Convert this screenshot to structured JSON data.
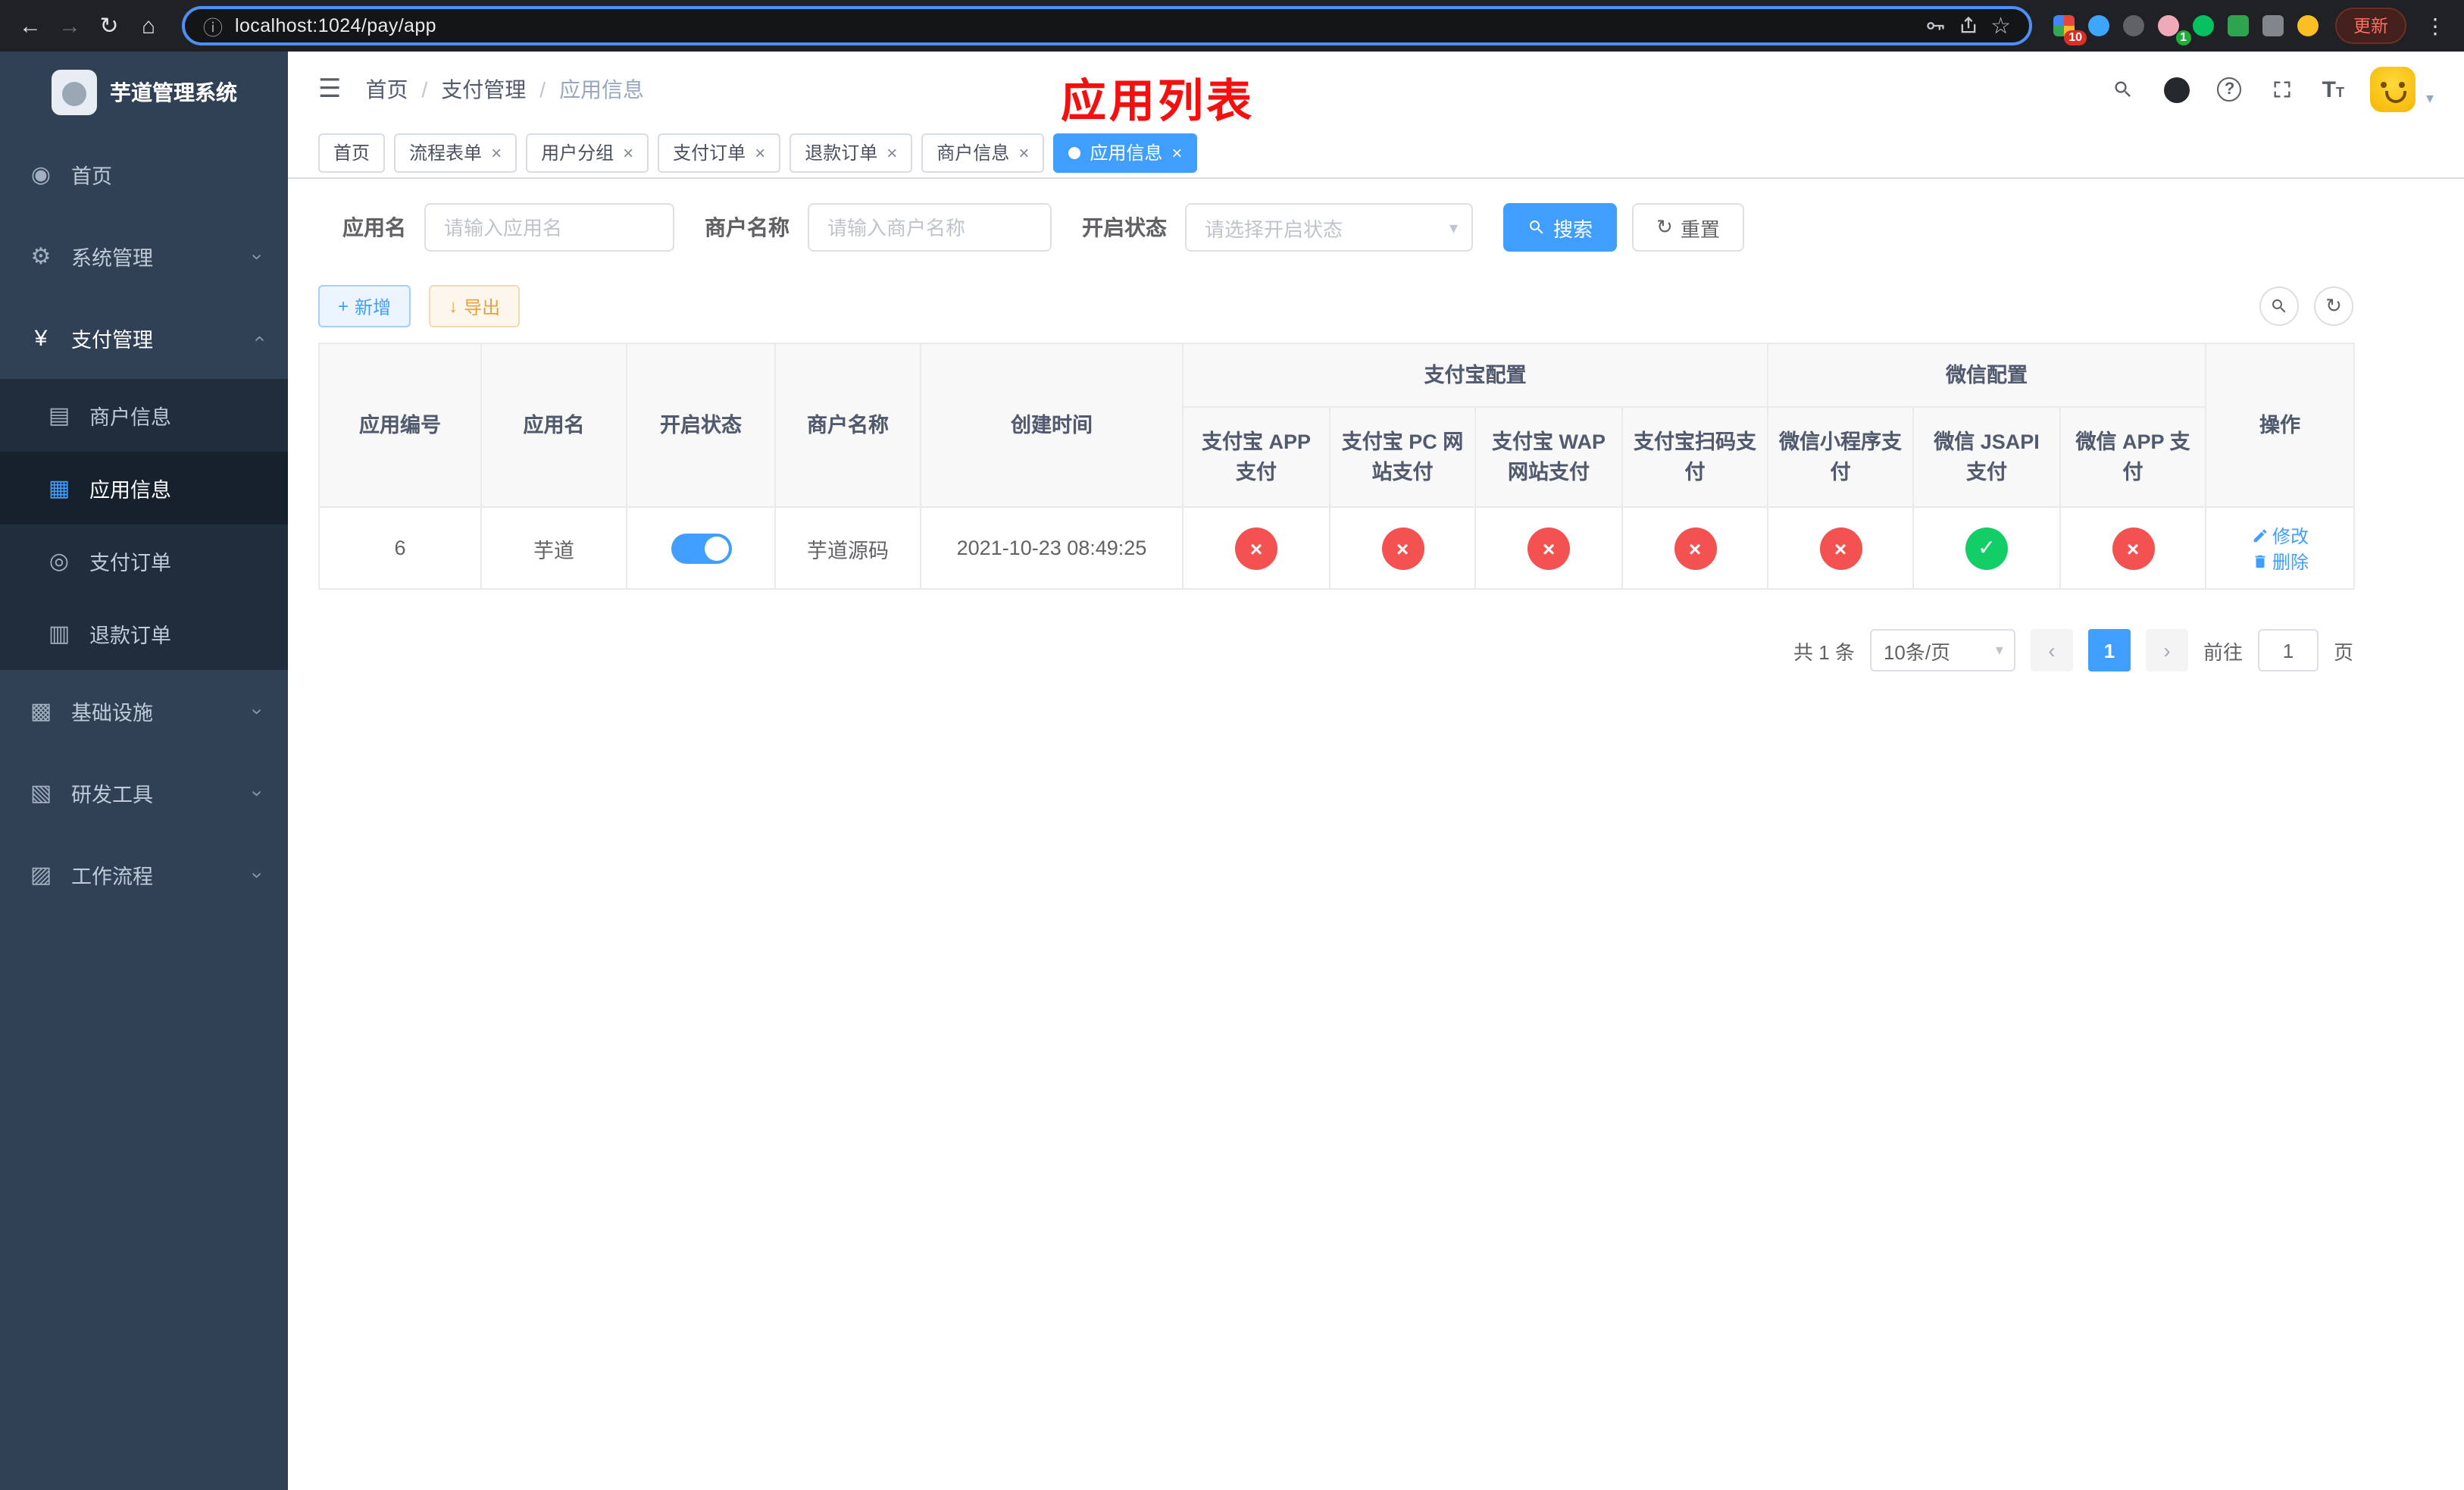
{
  "colors": {
    "accent": "#409eff",
    "success": "#13ce66",
    "danger": "#f45151",
    "title_red": "#f50f0f"
  },
  "browser": {
    "url": "localhost:1024/pay/app",
    "update_label": "更新",
    "ext_badge_grid": "10",
    "ext_badge_avatar": "1"
  },
  "icons": {
    "back": "←",
    "forward": "→",
    "refresh": "↻",
    "home": "⌂",
    "info": "ⓘ",
    "star": "☆",
    "kebab": "⋮",
    "hamburger": "☰",
    "chevron": "›",
    "caret": "▾",
    "close": "×",
    "plus": "+",
    "download": "↓",
    "question": "?",
    "font_t_large": "T",
    "font_t_small": "T",
    "prev": "‹",
    "next": "›",
    "check": "✓",
    "cross": "×",
    "menu_home": "◉",
    "menu_system": "⚙",
    "menu_pay": "¥",
    "menu_merchant": "▤",
    "menu_app": "▦",
    "menu_order": "◎",
    "menu_refund": "▥",
    "menu_infra": "▩",
    "menu_dev": "▧",
    "menu_flow": "▨"
  },
  "sidebar": {
    "title": "芋道管理系统",
    "items": [
      {
        "label": "首页"
      },
      {
        "label": "系统管理"
      },
      {
        "label": "支付管理"
      },
      {
        "label": "基础设施"
      },
      {
        "label": "研发工具"
      },
      {
        "label": "工作流程"
      }
    ],
    "pay_children": [
      {
        "label": "商户信息"
      },
      {
        "label": "应用信息",
        "active": true
      },
      {
        "label": "支付订单"
      },
      {
        "label": "退款订单"
      }
    ]
  },
  "header": {
    "breadcrumb": [
      "首页",
      "支付管理",
      "应用信息"
    ],
    "breadcrumb_sep": "/",
    "overlay_title": "应用列表"
  },
  "tabs": [
    {
      "label": "首页"
    },
    {
      "label": "流程表单"
    },
    {
      "label": "用户分组"
    },
    {
      "label": "支付订单"
    },
    {
      "label": "退款订单"
    },
    {
      "label": "商户信息"
    },
    {
      "label": "应用信息",
      "active": true
    }
  ],
  "filters": {
    "app_name_label": "应用名",
    "app_name_placeholder": "请输入应用名",
    "merchant_label": "商户名称",
    "merchant_placeholder": "请输入商户名称",
    "status_label": "开启状态",
    "status_placeholder": "请选择开启状态",
    "search_label": "搜索",
    "reset_label": "重置"
  },
  "toolbar": {
    "add_label": "新增",
    "export_label": "导出"
  },
  "table": {
    "columns": [
      "应用编号",
      "应用名",
      "开启状态",
      "商户名称",
      "创建时间",
      "操作"
    ],
    "group_headers": {
      "alipay": "支付宝配置",
      "wechat": "微信配置"
    },
    "channel_columns": [
      "支付宝 APP 支付",
      "支付宝 PC 网站支付",
      "支付宝 WAP 网站支付",
      "支付宝扫码支付",
      "微信小程序支付",
      "微信 JSAPI 支付",
      "微信 APP 支付"
    ],
    "row": {
      "id": "6",
      "name": "芋道",
      "enabled": true,
      "merchant": "芋道源码",
      "created": "2021-10-23 08:49:25",
      "channels": [
        false,
        false,
        false,
        false,
        false,
        true,
        false
      ],
      "edit_label": "修改",
      "delete_label": "删除"
    }
  },
  "pagination": {
    "total_label": "共 1 条",
    "page_size_label": "10条/页",
    "page": "1",
    "goto_label": "前往",
    "goto_value": "1",
    "unit_label": "页"
  }
}
